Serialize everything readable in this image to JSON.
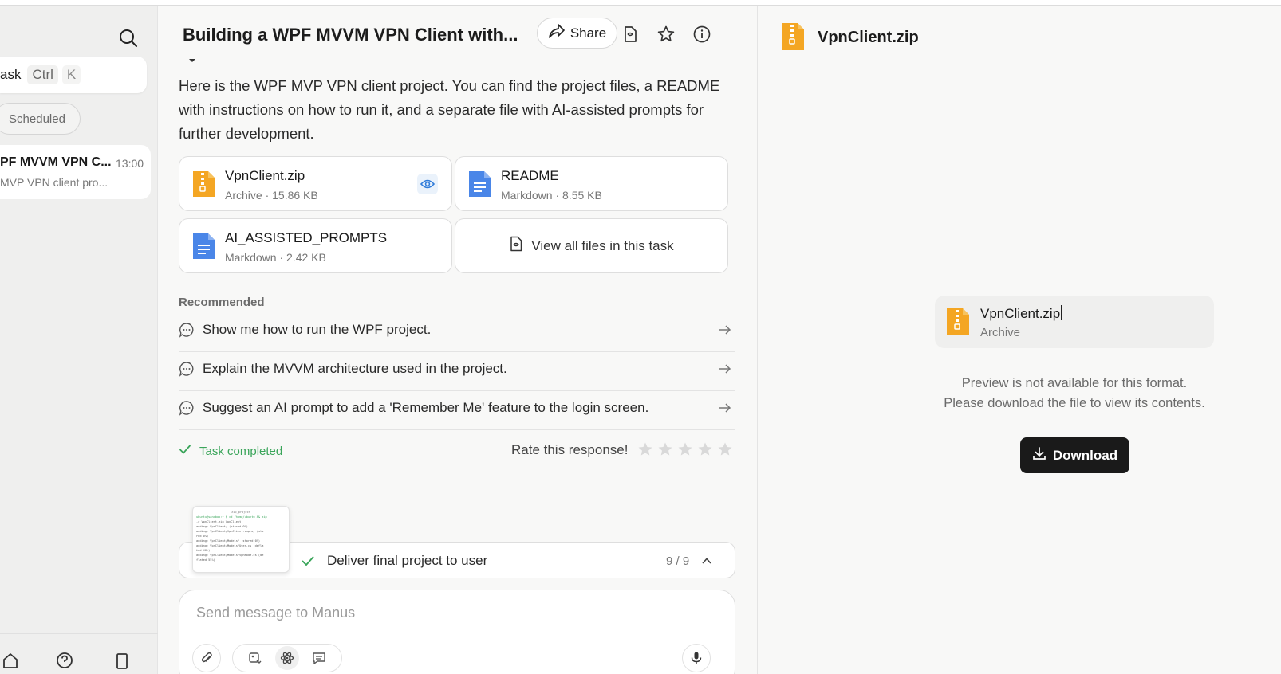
{
  "sidebar": {
    "new_task_label": "ask",
    "shortcut_ctrl": "Ctrl",
    "shortcut_k": "K",
    "filter_chip": "Scheduled",
    "task": {
      "title": "PF MVVM VPN C...",
      "time": "13:00",
      "subtitle": "MVP VPN client pro..."
    }
  },
  "chat": {
    "title": "Building a WPF MVVM VPN Client with...",
    "share_label": "Share",
    "message": "Here is the WPF MVP VPN client project. You can find the project files, a README with instructions on how to run it, and a separate file with AI-assisted prompts for further development.",
    "files": [
      {
        "name": "VpnClient.zip",
        "meta": "Archive · 15.86 KB",
        "icon": "zip-file-icon"
      },
      {
        "name": "README",
        "meta": "Markdown · 8.55 KB",
        "icon": "document-icon"
      },
      {
        "name": "AI_ASSISTED_PROMPTS",
        "meta": "Markdown · 2.42 KB",
        "icon": "document-icon"
      }
    ],
    "view_all_label": "View all files in this task",
    "recommended_label": "Recommended",
    "recommendations": [
      "Show me how to run the WPF project.",
      "Explain the MVVM architecture used in the project.",
      "Suggest an AI prompt to add a 'Remember Me' feature to the login screen."
    ],
    "status": "Task completed",
    "rate_label": "Rate this response!",
    "rating": {
      "value": 0,
      "max": 5
    },
    "terminal_preview": {
      "title": "zip_project",
      "lines": [
        "ubuntu@sandbox:~ $ cd /home/ubuntu && zip",
        "-r VpnClient.zip VpnClient",
        "  adding: VpnClient/ (stored 0%)",
        "  adding: VpnClient/VpnClient.csproj (sto",
        "red 0%)",
        "  adding: VpnClient/Models/ (stored 0%)",
        "  adding: VpnClient/Models/User.cs (defla",
        "ted 48%)",
        "  adding: VpnClient/Models/VpnNode.cs (de",
        "flated 55%)"
      ]
    },
    "progress": {
      "step": "Deliver final project to user",
      "count": "9 / 9"
    },
    "composer_placeholder": "Send message to Manus"
  },
  "preview": {
    "title": "VpnClient.zip",
    "file_name": "VpnClient.zip",
    "file_type": "Archive",
    "message_line1": "Preview is not available for this format.",
    "message_line2": "Please download the file to view its contents.",
    "download_label": "Download"
  },
  "colors": {
    "accent_green": "#3aa55a",
    "zip_orange": "#f4a623",
    "doc_blue": "#4a86e8",
    "download_bg": "#1a1a1a"
  }
}
